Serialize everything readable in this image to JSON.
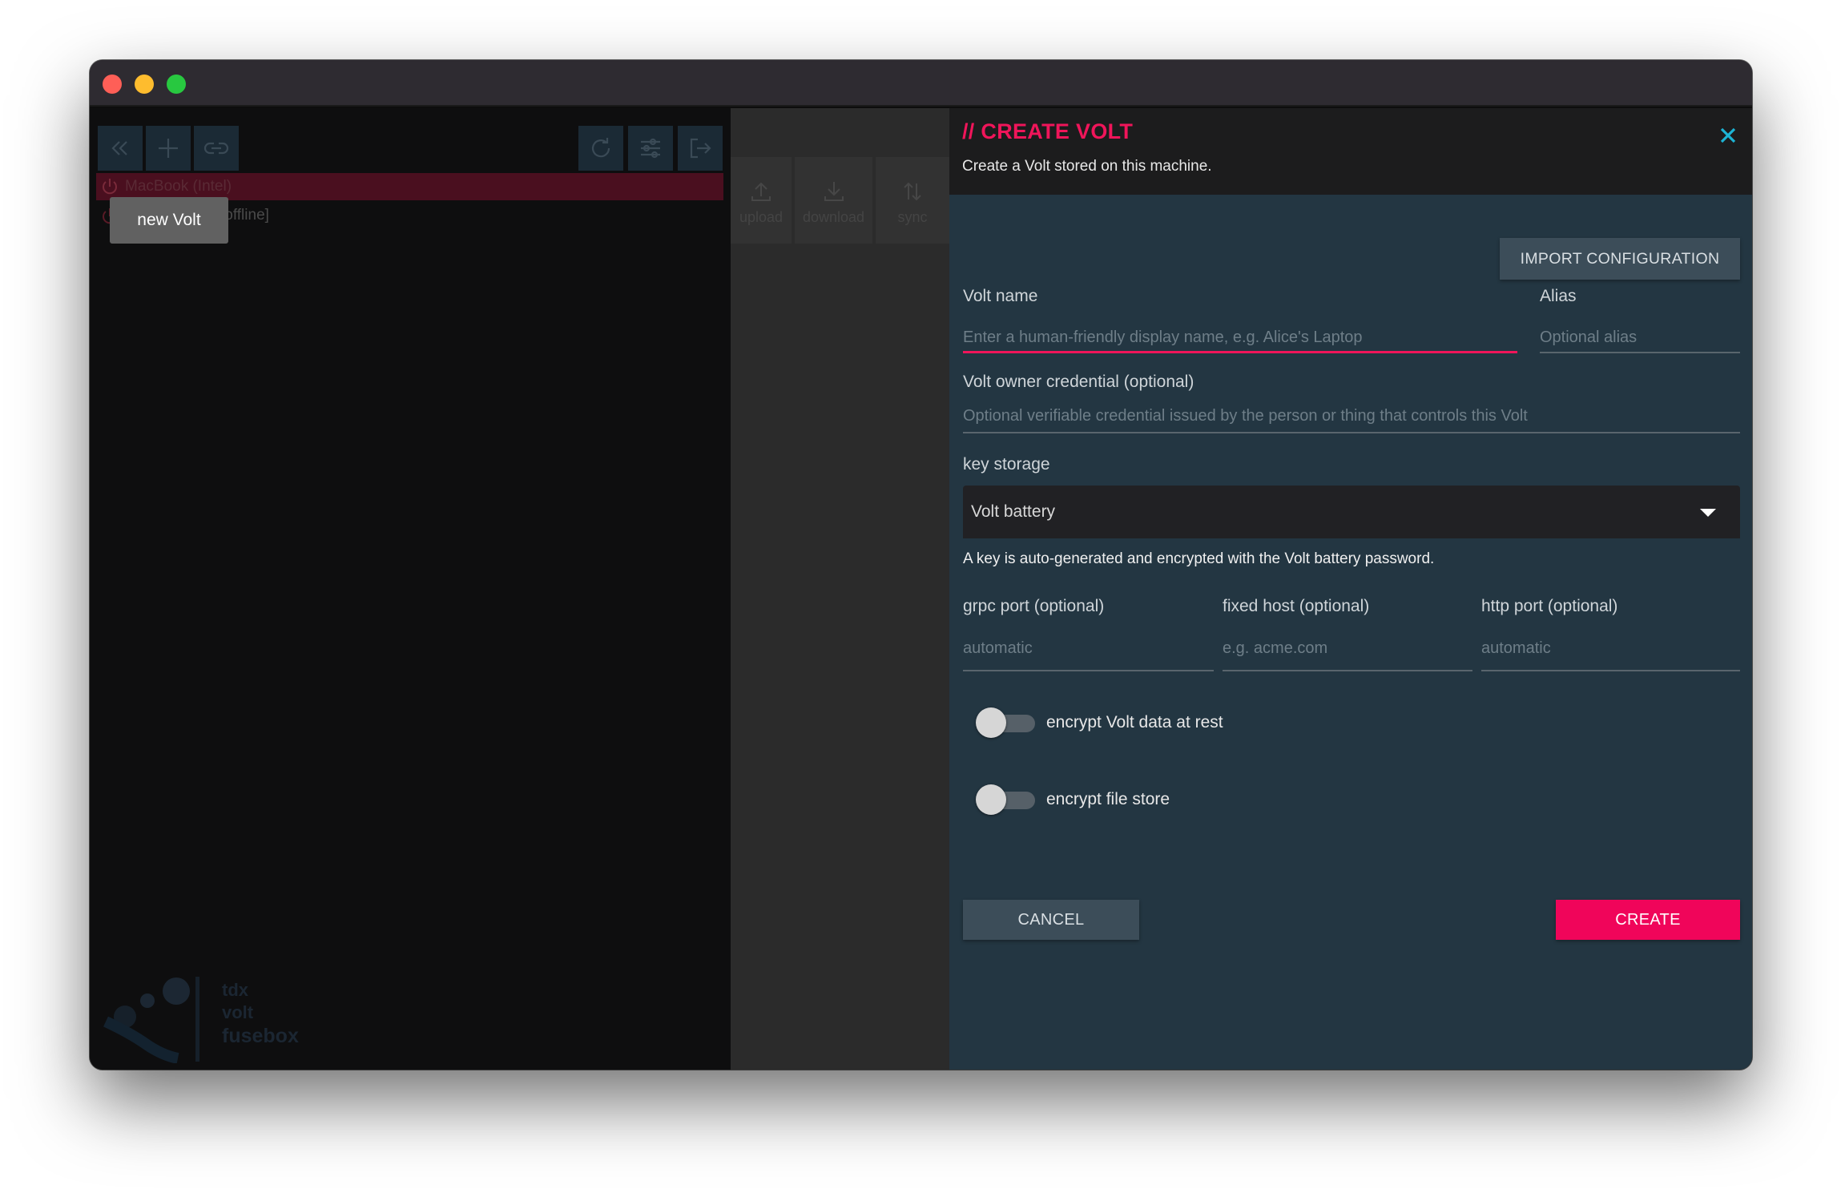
{
  "sidebar": {
    "items": [
      {
        "label": "MacBook (Intel)"
      },
      {
        "label": "[offline]"
      }
    ],
    "tooltip": "new Volt",
    "logo_lines": [
      "tdx",
      "volt",
      "fusebox"
    ]
  },
  "toolbar": {
    "left_icons": [
      "collapse-icon",
      "add-icon",
      "link-icon"
    ],
    "right_icons": [
      "refresh-icon",
      "settings-icon",
      "logout-icon"
    ]
  },
  "actions": {
    "upload_label": "upload",
    "download_label": "download",
    "sync_label": "sync"
  },
  "dialog": {
    "title": "// CREATE VOLT",
    "subtitle": "Create a Volt stored on this machine.",
    "import_label": "IMPORT CONFIGURATION",
    "volt_name": {
      "label": "Volt name",
      "placeholder": "Enter a human-friendly display name, e.g. Alice's Laptop",
      "value": ""
    },
    "alias": {
      "label": "Alias",
      "placeholder": "Optional alias",
      "value": ""
    },
    "owner_credential": {
      "label": "Volt owner credential (optional)",
      "placeholder": "Optional verifiable credential issued by the person or thing that controls this Volt",
      "value": ""
    },
    "key_storage": {
      "label": "key storage",
      "value": "Volt battery",
      "helper": "A key is auto-generated and encrypted with the Volt battery password."
    },
    "grpc_port": {
      "label": "grpc port (optional)",
      "placeholder": "automatic"
    },
    "fixed_host": {
      "label": "fixed host (optional)",
      "placeholder": "e.g. acme.com"
    },
    "http_port": {
      "label": "http port (optional)",
      "placeholder": "automatic"
    },
    "encrypt_data": {
      "label": "encrypt Volt data at rest",
      "enabled": false
    },
    "encrypt_files": {
      "label": "encrypt file store",
      "enabled": false
    },
    "cancel_label": "CANCEL",
    "create_label": "CREATE"
  },
  "colors": {
    "accent": "#f0155a",
    "panel_bg": "#233642",
    "close_icon": "#1db3d4"
  }
}
